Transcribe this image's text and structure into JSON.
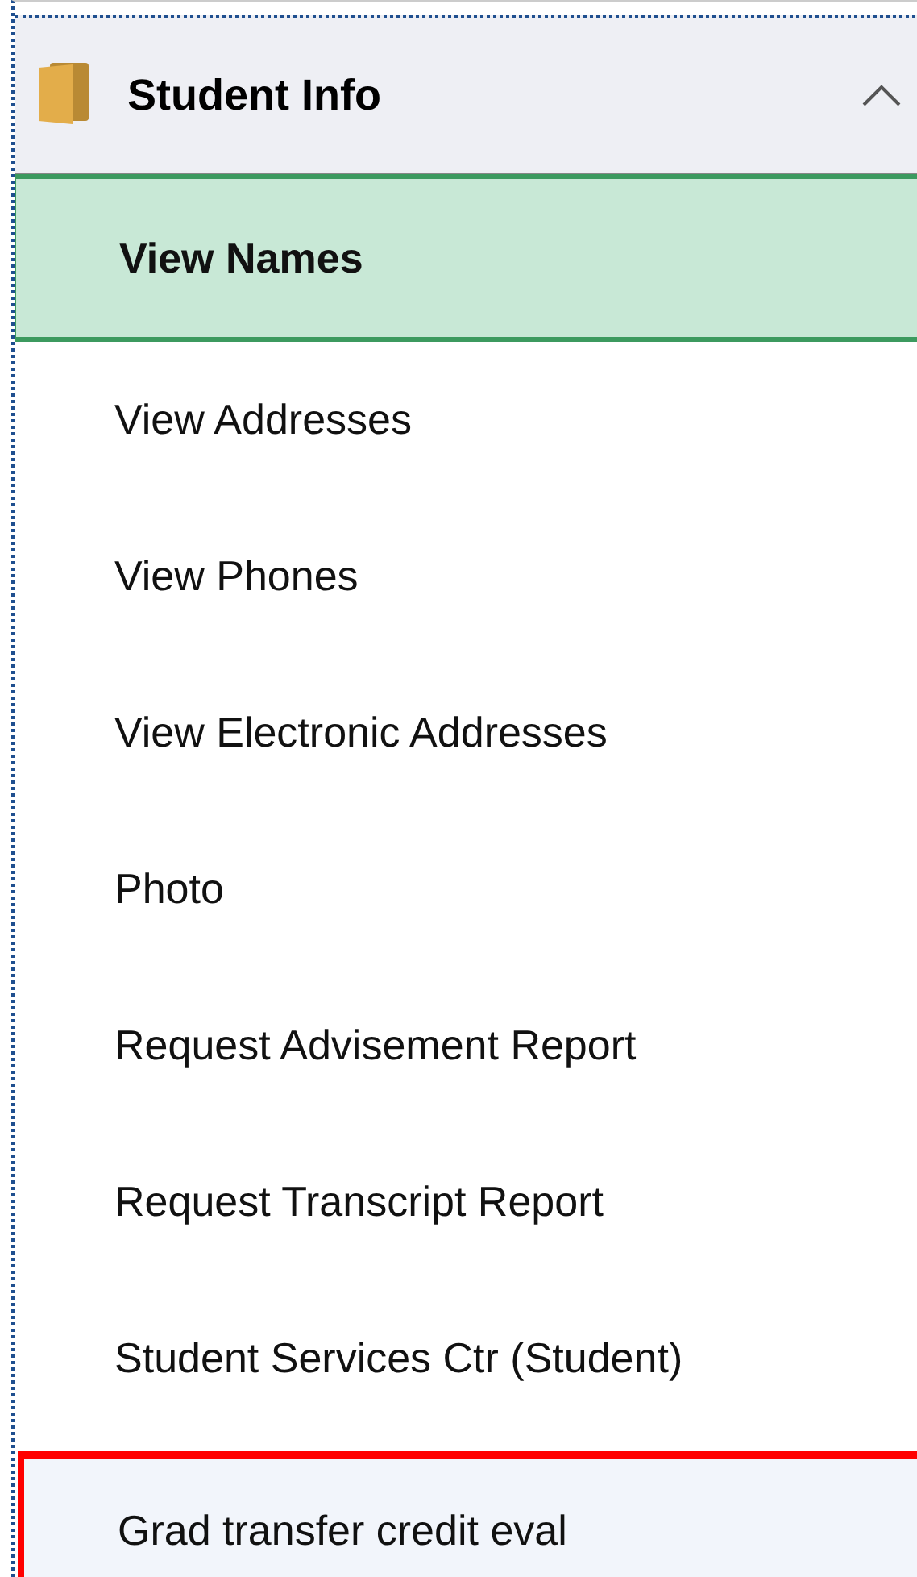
{
  "section": {
    "title": "Student Info",
    "expanded": true
  },
  "items": [
    {
      "label": "View Names",
      "selected": true,
      "highlighted": false
    },
    {
      "label": "View Addresses",
      "selected": false,
      "highlighted": false
    },
    {
      "label": "View Phones",
      "selected": false,
      "highlighted": false
    },
    {
      "label": "View Electronic Addresses",
      "selected": false,
      "highlighted": false
    },
    {
      "label": "Photo",
      "selected": false,
      "highlighted": false
    },
    {
      "label": "Request Advisement Report",
      "selected": false,
      "highlighted": false
    },
    {
      "label": "Request Transcript Report",
      "selected": false,
      "highlighted": false
    },
    {
      "label": "Student Services Ctr (Student)",
      "selected": false,
      "highlighted": false
    },
    {
      "label": "Grad transfer credit eval",
      "selected": false,
      "highlighted": true
    }
  ]
}
